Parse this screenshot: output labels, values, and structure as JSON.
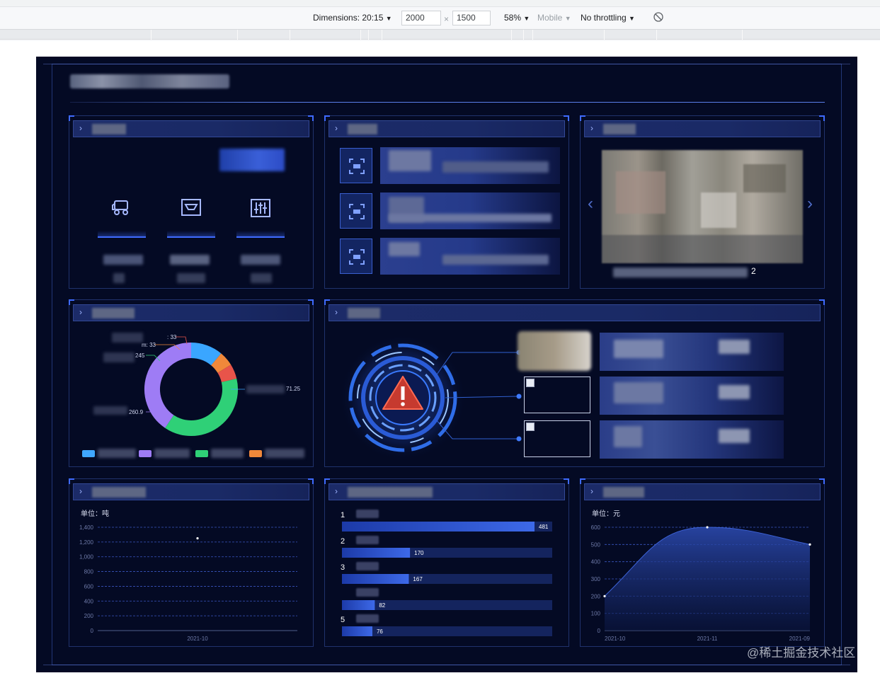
{
  "devtools": {
    "dimensions_label": "Dimensions: 20:15",
    "width_value": "2000",
    "times_sign": "×",
    "height_value": "1500",
    "zoom": "58%",
    "device": "Mobile",
    "throttling": "No throttling",
    "dropdown_arrow": "▼"
  },
  "status_panel": {
    "legend_labels": [
      "",
      "",
      "",
      ""
    ],
    "legend_colors": [
      "#3fa7ff",
      "#9e7cf5",
      "#2fd077",
      "#f0883a"
    ]
  },
  "donut": {
    "labels": [
      ": 33",
      "m: 33",
      "245",
      "71.25",
      "260.9"
    ],
    "segments": [
      {
        "value": 71.25,
        "color": "#3aa6ff"
      },
      {
        "value": 33,
        "color": "#f0883a"
      },
      {
        "value": 33,
        "color": "#e8544a"
      },
      {
        "value": 245,
        "color": "#2fd077"
      },
      {
        "value": 260.9,
        "color": "#9e7cf5"
      }
    ]
  },
  "carousel": {
    "page_index": "2",
    "prev_icon": "chevron-left-icon",
    "next_icon": "chevron-right-icon"
  },
  "line_chart_left": {
    "unit": "单位：吨"
  },
  "ranking": {
    "ranks": [
      "1",
      "2",
      "3",
      "",
      "5"
    ]
  },
  "area_chart": {
    "unit": "单位：元"
  },
  "chart_data": [
    {
      "type": "line",
      "x": [
        "2021-10"
      ],
      "series": [
        {
          "values": [
            1250
          ]
        }
      ],
      "ylim": [
        0,
        1400
      ],
      "yticks": [
        "0",
        "200",
        "400",
        "600",
        "800",
        "1,000",
        "1,200",
        "1,400"
      ],
      "grid": true
    },
    {
      "type": "bar",
      "orientation": "horizontal",
      "categories": [
        "1",
        "2",
        "3",
        "",
        "5"
      ],
      "values": [
        481,
        170,
        167,
        82,
        76
      ],
      "max": 481
    },
    {
      "type": "area",
      "x": [
        "2021-10",
        "2021-11",
        "2021-09"
      ],
      "series": [
        {
          "values": [
            200,
            600,
            500
          ]
        }
      ],
      "ylim": [
        0,
        600
      ],
      "yticks": [
        "0",
        "100",
        "200",
        "300",
        "400",
        "500",
        "600"
      ],
      "grid": true
    }
  ],
  "watermark": "@稀土掘金技术社区"
}
